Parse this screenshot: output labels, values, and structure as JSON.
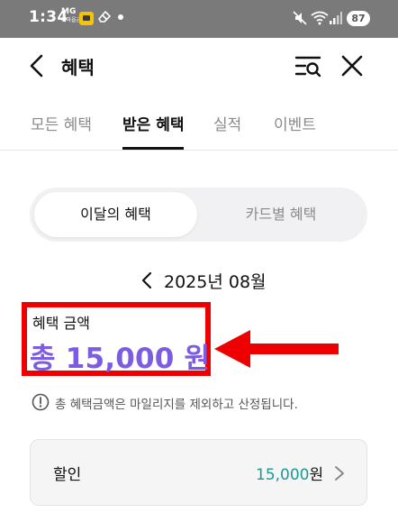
{
  "status_bar": {
    "time": "1:34",
    "carrier_mark": "MG",
    "carrier_sub": "새마을금고",
    "battery": "87",
    "icons": [
      "app-badge-icon",
      "eraser-icon",
      "dot-icon",
      "mute-icon",
      "wifi-icon",
      "signal-icon",
      "battery-icon"
    ]
  },
  "header": {
    "title": "혜택",
    "icons": [
      "back-arrow-icon",
      "search-filter-icon",
      "close-icon"
    ]
  },
  "tabs": [
    {
      "label": "모든 혜택",
      "active": false
    },
    {
      "label": "받은 혜택",
      "active": true
    },
    {
      "label": "실적",
      "active": false
    },
    {
      "label": "이벤트",
      "active": false
    }
  ],
  "segmented": {
    "options": [
      "이달의 혜택",
      "카드별 혜택"
    ],
    "selected": "이달의 혜택"
  },
  "month": {
    "label": "2025년 08월"
  },
  "benefit": {
    "label": "혜택 금액",
    "total": "총 15,000 원"
  },
  "notice": {
    "text": "총 혜택금액은 마일리지를 제외하고 산정됩니다."
  },
  "discount_card": {
    "label": "할인",
    "value_number": "15,000",
    "value_unit": "원"
  },
  "colors": {
    "accent_purple": "#7c5ce0",
    "teal": "#1a9a91",
    "highlight_red": "#ef0000",
    "status_bar": "#7a7a7a"
  }
}
